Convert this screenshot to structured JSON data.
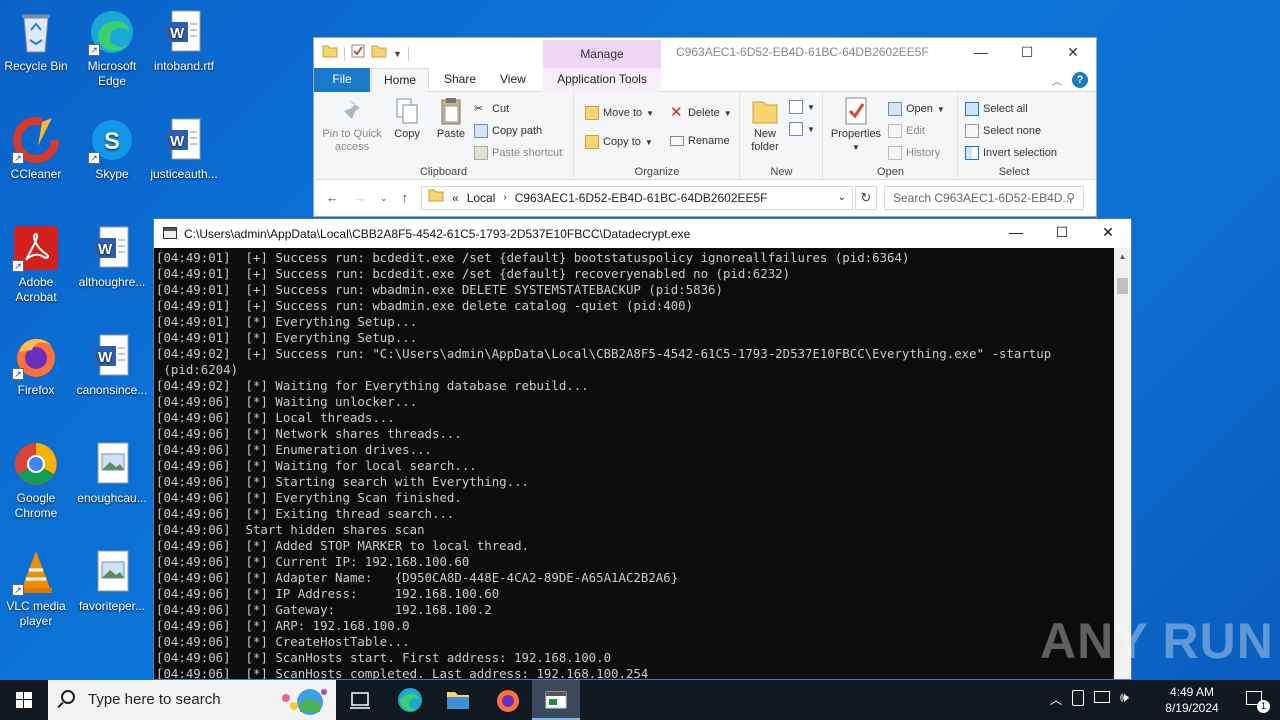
{
  "desktop": {
    "icons": [
      {
        "label": "Recycle Bin"
      },
      {
        "label": "Microsoft Edge"
      },
      {
        "label": "intoband.rtf"
      },
      {
        "label": "CCleaner"
      },
      {
        "label": "Skype"
      },
      {
        "label": "justiceauth..."
      },
      {
        "label": "Adobe Acrobat"
      },
      {
        "label": "althoughre..."
      },
      {
        "label": "Firefox"
      },
      {
        "label": "canonsince..."
      },
      {
        "label": "Google Chrome"
      },
      {
        "label": "enoughcau..."
      },
      {
        "label": "VLC media player"
      },
      {
        "label": "favoriteper..."
      }
    ]
  },
  "explorer": {
    "title": "C963AEC1-6D52-EB4D-61BC-64DB2602EE5F",
    "manage_tab": "Manage",
    "tabs": {
      "file": "File",
      "home": "Home",
      "share": "Share",
      "view": "View",
      "app_tools": "Application Tools"
    },
    "clipboard": {
      "pin": "Pin to Quick access",
      "copy": "Copy",
      "paste": "Paste",
      "cut": "Cut",
      "copy_path": "Copy path",
      "paste_shortcut": "Paste shortcut",
      "label": "Clipboard"
    },
    "organize": {
      "move_to": "Move to",
      "copy_to": "Copy to",
      "delete": "Delete",
      "rename": "Rename",
      "label": "Organize"
    },
    "new": {
      "new_folder": "New folder",
      "label": "New"
    },
    "open": {
      "properties": "Properties",
      "open": "Open",
      "edit": "Edit",
      "history": "History",
      "label": "Open"
    },
    "select": {
      "select_all": "Select all",
      "select_none": "Select none",
      "invert": "Invert selection",
      "label": "Select"
    },
    "address": {
      "prefix": "«",
      "local": "Local",
      "folder": "C963AEC1-6D52-EB4D-61BC-64DB2602EE5F"
    },
    "search_placeholder": "Search C963AEC1-6D52-EB4D..."
  },
  "console": {
    "title": "C:\\Users\\admin\\AppData\\Local\\CBB2A8F5-4542-61C5-1793-2D537E10FBCC\\Datadecrypt.exe",
    "lines": [
      "[04:49:01]  [+] Success run: bcdedit.exe /set {default} bootstatuspolicy ignoreallfailures (pid:6364)",
      "[04:49:01]  [+] Success run: bcdedit.exe /set {default} recoveryenabled no (pid:6232)",
      "[04:49:01]  [+] Success run: wbadmin.exe DELETE SYSTEMSTATEBACKUP (pid:5836)",
      "[04:49:01]  [+] Success run: wbadmin.exe delete catalog -quiet (pid:400)",
      "[04:49:01]  [*] Everything Setup...",
      "[04:49:01]  [*] Everything Setup...",
      "[04:49:02]  [+] Success run: \"C:\\Users\\admin\\AppData\\Local\\CBB2A8F5-4542-61C5-1793-2D537E10FBCC\\Everything.exe\" -startup",
      " (pid:6204)",
      "[04:49:02]  [*] Waiting for Everything database rebuild...",
      "[04:49:06]  [*] Waiting unlocker...",
      "[04:49:06]  [*] Local threads...",
      "[04:49:06]  [*] Network shares threads...",
      "[04:49:06]  [*] Enumeration drives...",
      "[04:49:06]  [*] Waiting for local search...",
      "[04:49:06]  [*] Starting search with Everything...",
      "[04:49:06]  [*] Everything Scan finished.",
      "[04:49:06]  [*] Exiting thread search...",
      "[04:49:06]  Start hidden shares scan",
      "[04:49:06]  [*] Added STOP MARKER to local thread.",
      "[04:49:06]  [*] Current IP: 192.168.100.60",
      "[04:49:06]  [*] Adapter Name:   {D950CA8D-448E-4CA2-89DE-A65A1AC2B2A6}",
      "[04:49:06]  [*] IP Address:     192.168.100.60",
      "[04:49:06]  [*] Gateway:        192.168.100.2",
      "[04:49:06]  [*] ARP: 192.168.100.0",
      "[04:49:06]  [*] CreateHostTable...",
      "[04:49:06]  [*] ScanHosts start. First address: 192.168.100.0",
      "[04:49:06]  [*] ScanHosts completed. Last address: 192.168.100.254"
    ]
  },
  "watermark": "ANY RUN",
  "taskbar": {
    "search_placeholder": "Type here to search",
    "time": "4:49 AM",
    "date": "8/19/2024",
    "notification_count": "1"
  }
}
